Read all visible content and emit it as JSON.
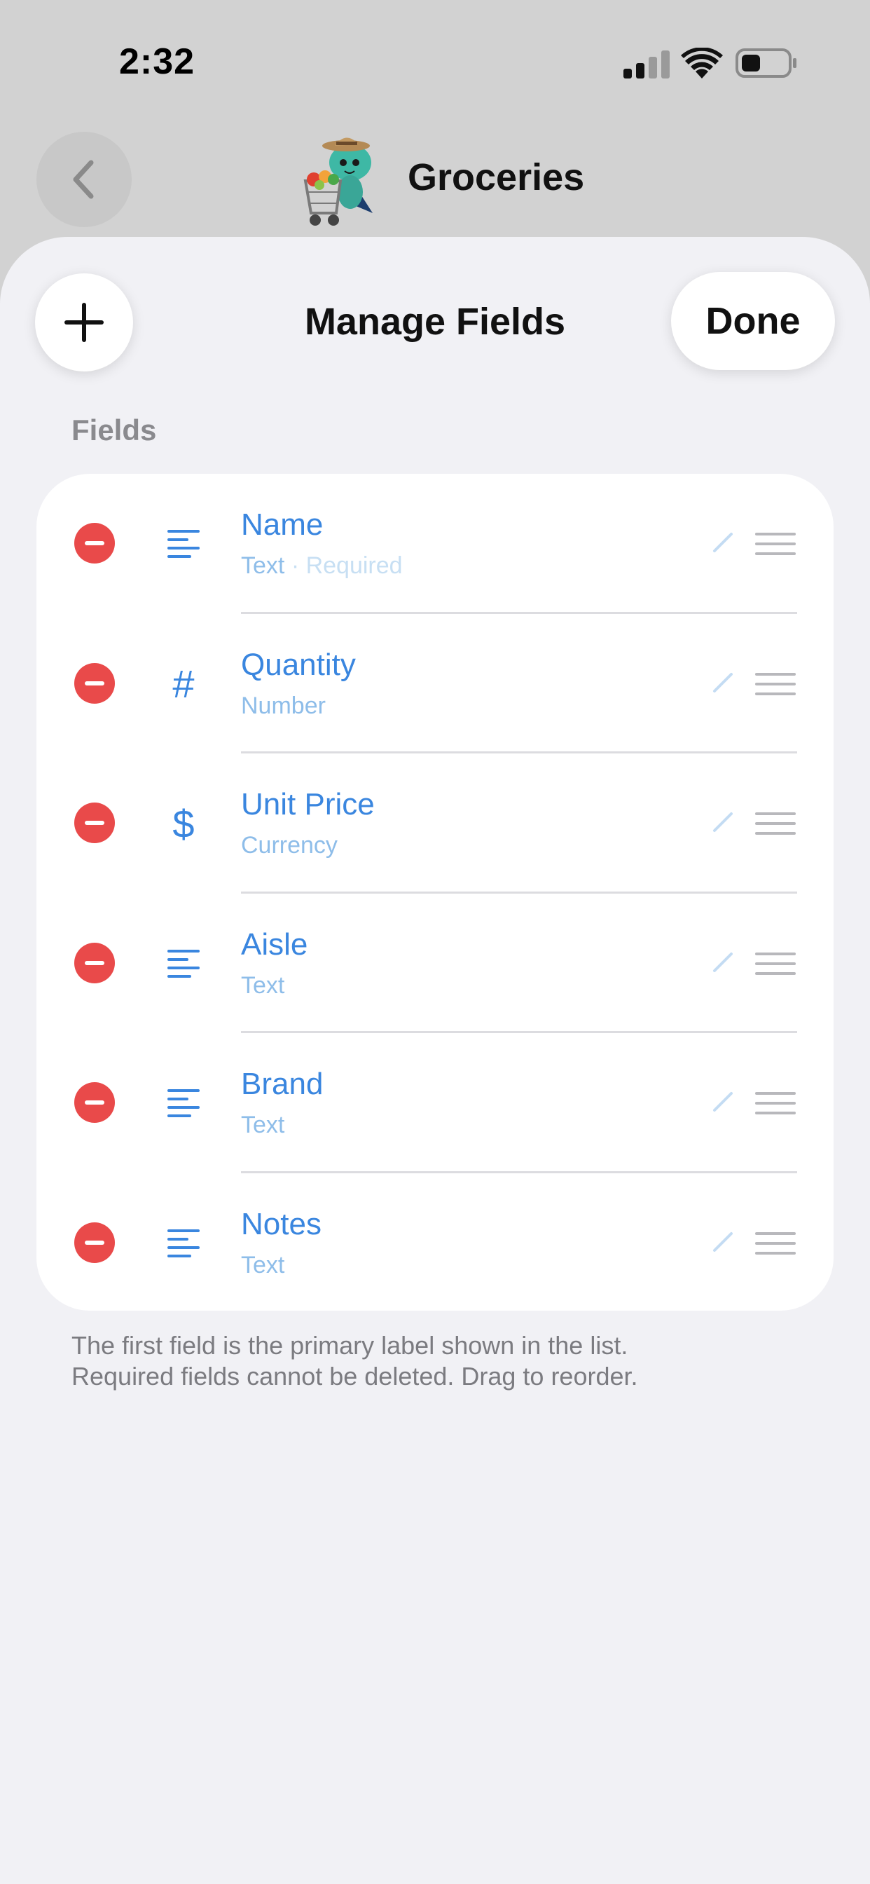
{
  "status_bar": {
    "time": "2:32",
    "icons": [
      "cellular-signal-icon",
      "wifi-icon",
      "battery-icon"
    ]
  },
  "nav": {
    "back_icon": "chevron-left-icon",
    "avatar": "grocery-cart-mascot",
    "title": "Groceries"
  },
  "sheet": {
    "add_icon": "plus-icon",
    "title": "Manage Fields",
    "done_label": "Done",
    "section_header": "Fields",
    "fields": [
      {
        "name": "Name",
        "type": "Text",
        "required": "· Required",
        "icon": "text-lines-icon",
        "glyph": ""
      },
      {
        "name": "Quantity",
        "type": "Number",
        "required": "",
        "icon": "hash-icon",
        "glyph": "#"
      },
      {
        "name": "Unit Price",
        "type": "Currency",
        "required": "",
        "icon": "dollar-icon",
        "glyph": "$"
      },
      {
        "name": "Aisle",
        "type": "Text",
        "required": "",
        "icon": "text-lines-icon",
        "glyph": ""
      },
      {
        "name": "Brand",
        "type": "Text",
        "required": "",
        "icon": "text-lines-icon",
        "glyph": ""
      },
      {
        "name": "Notes",
        "type": "Text",
        "required": "",
        "icon": "text-lines-icon",
        "glyph": ""
      }
    ],
    "footer_line1": "The first field is the primary label shown in the list.",
    "footer_line2": "Required fields cannot be deleted. Drag to reorder."
  },
  "colors": {
    "accent": "#3a86df",
    "accent_light": "#8ebde9",
    "delete": "#e94a4a",
    "sheet_bg": "#f1f1f5",
    "backdrop": "#d2d2d2"
  }
}
